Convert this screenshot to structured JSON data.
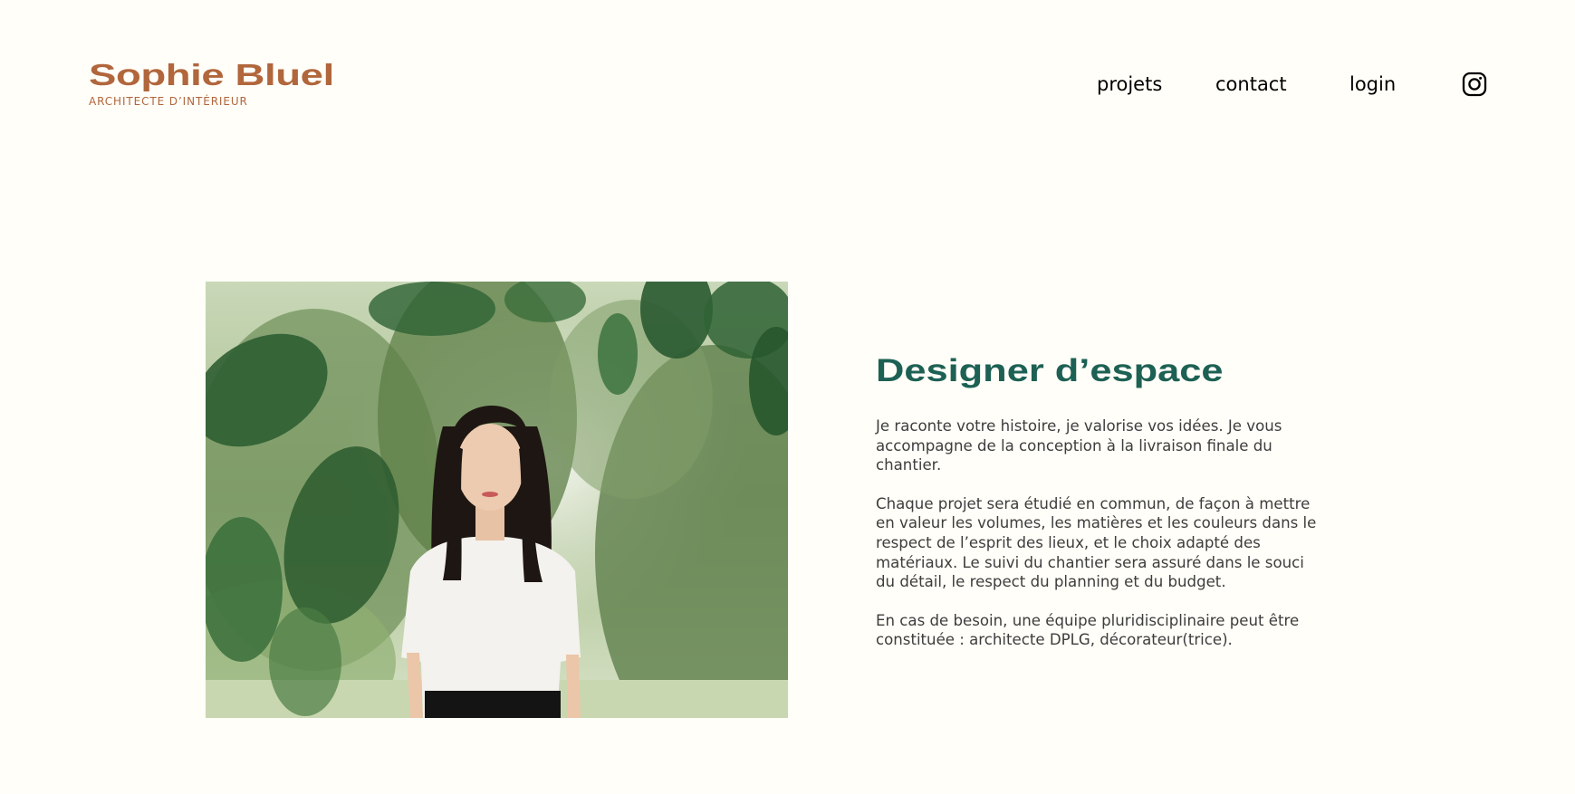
{
  "header": {
    "brand": "Sophie Bluel",
    "subtitle": "ARCHITECTE D’INTÉRIEUR"
  },
  "nav": {
    "projets": "projets",
    "contact": "contact",
    "login": "login",
    "instagram_icon": "instagram-icon"
  },
  "intro": {
    "title": "Designer d’espace",
    "p1": [
      "Je raconte votre histoire, je valorise vos idées. Je vous",
      "accompagne de la conception à la livraison finale du",
      "chantier."
    ],
    "p2": [
      "Chaque projet sera étudié en commun, de façon à mettre",
      "en valeur les volumes, les matières et les couleurs dans le",
      "respect de l’esprit des lieux, et le choix adapté des",
      "matériaux. Le suivi du chantier sera assuré dans le souci",
      "du détail, le respect du planning et du budget."
    ],
    "p3": [
      "En cas de besoin, une équipe pluridisciplinaire peut être",
      "constituée : architecte DPLG, décorateur(trice)."
    ]
  },
  "colors": {
    "background": "#FFFEF8",
    "brand": "#B1663C",
    "title": "#1D6154",
    "text": "#3D3D3D"
  }
}
